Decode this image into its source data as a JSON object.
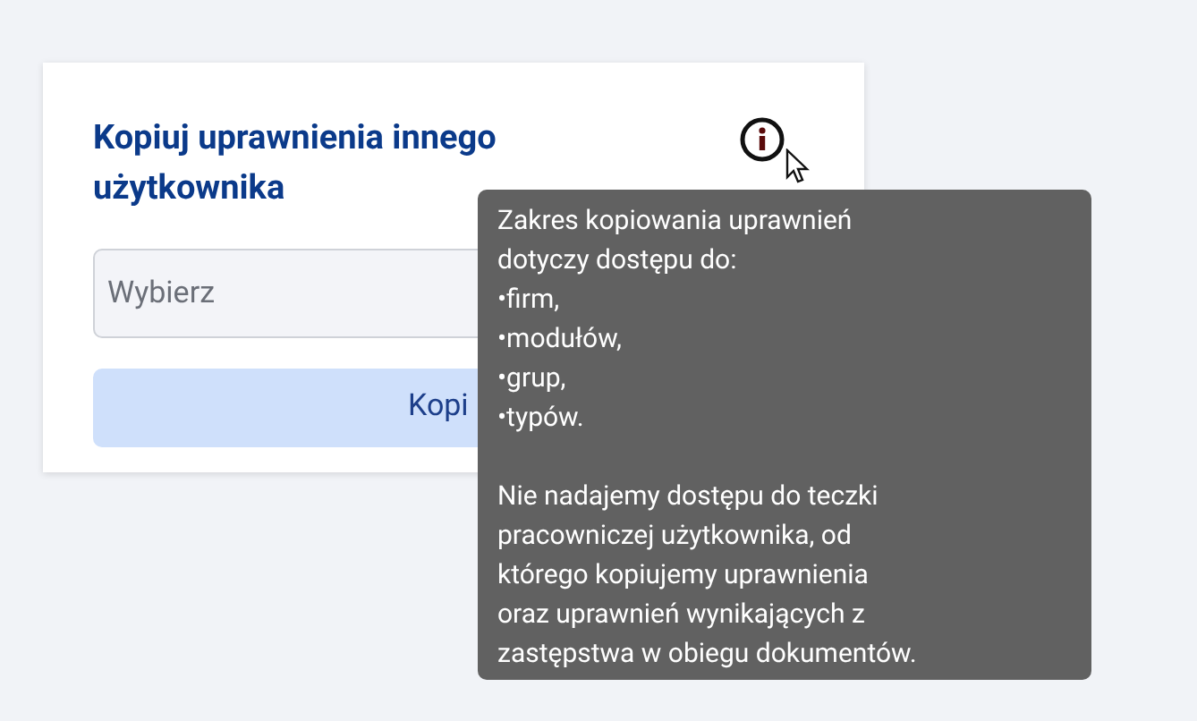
{
  "card": {
    "title": "Kopiuj uprawnienia innego użytkownika",
    "select": {
      "placeholder": "Wybierz"
    },
    "button": {
      "label": "Kopi"
    }
  },
  "tooltip": {
    "paragraphs": [
      "Zakres kopiowania uprawnień\ndotyczy dostępu do:\n•firm,\n•modułów,\n•grup,\n•typów.",
      "Nie nadajemy dostępu do teczki\npracowniczej użytkownika, od\nktórego kopiujemy uprawnienia\noraz uprawnień wynikających z\nzastępstwa w obiegu dokumentów."
    ]
  }
}
